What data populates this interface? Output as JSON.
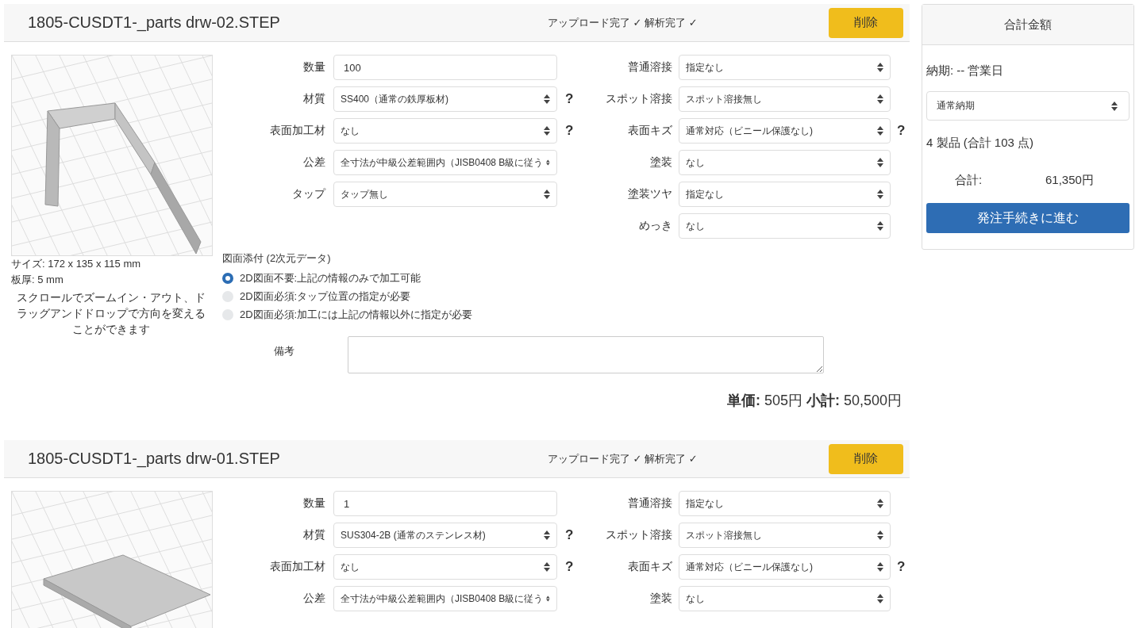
{
  "parts": [
    {
      "filename": "1805-CUSDT1-_parts drw-02.STEP",
      "status": "アップロード完了 ✓ 解析完了 ✓",
      "delete_label": "削除",
      "preview": {
        "kind": "bracket"
      },
      "size": "サイズ: 172 x 135 x 115 mm",
      "thickness": "板厚: 5 mm",
      "hint": "スクロールでズームイン・アウト、ドラッグアンドドロップで方向を変えることができます",
      "left_fields": [
        {
          "label": "数量",
          "kind": "input",
          "value": "100"
        },
        {
          "label": "材質",
          "kind": "select",
          "value": "SS400（通常の鉄厚板材)",
          "help": "?"
        },
        {
          "label": "表面加工材",
          "kind": "select",
          "value": "なし",
          "help": "?"
        },
        {
          "label": "公差",
          "kind": "select",
          "value": "全寸法が中級公差範囲内（JISB0408 B級に従う"
        },
        {
          "label": "タップ",
          "kind": "select",
          "value": "タップ無し"
        }
      ],
      "right_fields": [
        {
          "label": "普通溶接",
          "kind": "select",
          "value": "指定なし"
        },
        {
          "label": "スポット溶接",
          "kind": "select",
          "value": "スポット溶接無し"
        },
        {
          "label": "表面キズ",
          "kind": "select",
          "value": "通常対応（ビニール保護なし)",
          "help": "?"
        },
        {
          "label": "塗装",
          "kind": "select",
          "value": "なし"
        },
        {
          "label": "塗装ツヤ",
          "kind": "select",
          "value": "指定なし"
        },
        {
          "label": "めっき",
          "kind": "select",
          "value": "なし"
        }
      ],
      "attachment": {
        "title": "図面添付 (2次元データ)",
        "options": [
          {
            "label": "2D図面不要:上記の情報のみで加工可能",
            "selected": true
          },
          {
            "label": "2D図面必須:タップ位置の指定が必要",
            "selected": false
          },
          {
            "label": "2D図面必須:加工には上記の情報以外に指定が必要",
            "selected": false
          }
        ]
      },
      "note_label": "備考",
      "price": "**単価:** 505円 **小計:** 50,500円"
    },
    {
      "filename": "1805-CUSDT1-_parts drw-01.STEP",
      "status": "アップロード完了 ✓ 解析完了 ✓",
      "delete_label": "削除",
      "preview": {
        "kind": "plate"
      },
      "left_fields": [
        {
          "label": "数量",
          "kind": "input",
          "value": "1"
        },
        {
          "label": "材質",
          "kind": "select",
          "value": "SUS304-2B (通常のステンレス材)",
          "help": "?"
        },
        {
          "label": "表面加工材",
          "kind": "select",
          "value": "なし",
          "help": "?"
        },
        {
          "label": "公差",
          "kind": "select",
          "value": "全寸法が中級公差範囲内（JISB0408 B級に従う"
        }
      ],
      "right_fields": [
        {
          "label": "普通溶接",
          "kind": "select",
          "value": "指定なし"
        },
        {
          "label": "スポット溶接",
          "kind": "select",
          "value": "スポット溶接無し"
        },
        {
          "label": "表面キズ",
          "kind": "select",
          "value": "通常対応（ビニール保護なし)",
          "help": "?"
        },
        {
          "label": "塗装",
          "kind": "select",
          "value": "なし"
        }
      ]
    }
  ],
  "summary": {
    "title": "合計金額",
    "delivery": "納期: -- 営業日",
    "delivery_option": "通常納期",
    "count": "4 製品 (合計 103 点)",
    "total_label": "合計:",
    "total_value": "61,350円",
    "checkout_label": "発注手続きに進む"
  }
}
